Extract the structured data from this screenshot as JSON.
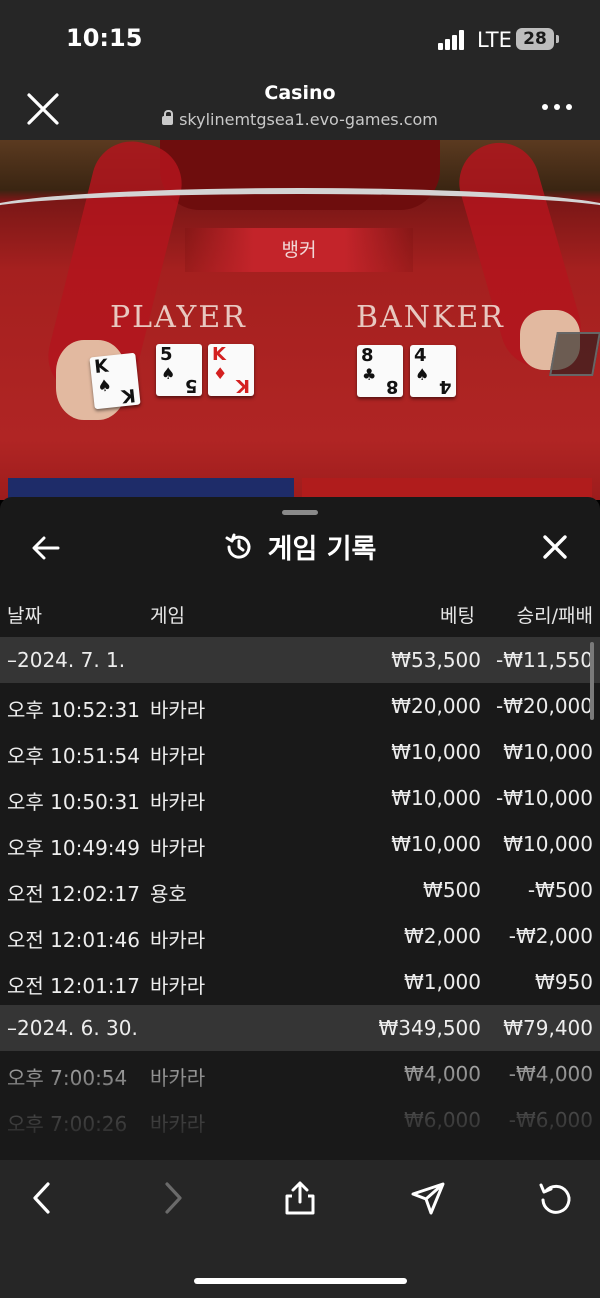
{
  "status_bar": {
    "time": "10:15",
    "network": "LTE",
    "battery": "28"
  },
  "browser": {
    "title": "Casino",
    "url": "skylinemtgsea1.evo-games.com"
  },
  "game": {
    "banner": "뱅커",
    "player_label": "PLAYER",
    "banker_label": "BANKER",
    "player_cards": [
      {
        "rank": "K",
        "suit": "♠"
      },
      {
        "rank": "5",
        "suit": "♠"
      },
      {
        "rank": "K",
        "suit": "♦"
      }
    ],
    "banker_cards": [
      {
        "rank": "8",
        "suit": "♣"
      },
      {
        "rank": "4",
        "suit": "♠"
      }
    ]
  },
  "panel": {
    "title": "게임 기록",
    "columns": {
      "date": "날짜",
      "game": "게임",
      "bet": "베팅",
      "win_loss": "승리/패배"
    },
    "rows": [
      {
        "type": "group",
        "date": "–2024. 7. 1.",
        "game": "",
        "bet": "₩53,500",
        "win_loss": "-₩11,550"
      },
      {
        "type": "item",
        "date": "오후 10:52:31",
        "game": "바카라",
        "bet": "₩20,000",
        "win_loss": "-₩20,000"
      },
      {
        "type": "item",
        "date": "오후 10:51:54",
        "game": "바카라",
        "bet": "₩10,000",
        "win_loss": "₩10,000"
      },
      {
        "type": "item",
        "date": "오후 10:50:31",
        "game": "바카라",
        "bet": "₩10,000",
        "win_loss": "-₩10,000"
      },
      {
        "type": "item",
        "date": "오후 10:49:49",
        "game": "바카라",
        "bet": "₩10,000",
        "win_loss": "₩10,000"
      },
      {
        "type": "item",
        "date": "오전 12:02:17",
        "game": "용호",
        "bet": "₩500",
        "win_loss": "-₩500"
      },
      {
        "type": "item",
        "date": "오전 12:01:46",
        "game": "바카라",
        "bet": "₩2,000",
        "win_loss": "-₩2,000"
      },
      {
        "type": "item",
        "date": "오전 12:01:17",
        "game": "바카라",
        "bet": "₩1,000",
        "win_loss": "₩950"
      },
      {
        "type": "group",
        "date": "–2024. 6. 30.",
        "game": "",
        "bet": "₩349,500",
        "win_loss": "₩79,400"
      },
      {
        "type": "item",
        "date": "오후 7:00:54",
        "game": "바카라",
        "bet": "₩4,000",
        "win_loss": "-₩4,000"
      },
      {
        "type": "item",
        "date": "오후 7:00:26",
        "game": "바카라",
        "bet": "₩6,000",
        "win_loss": "-₩6,000"
      }
    ]
  },
  "toolbar": {
    "icons": [
      "back-icon",
      "forward-icon",
      "share-icon",
      "send-icon",
      "reload-icon"
    ]
  }
}
